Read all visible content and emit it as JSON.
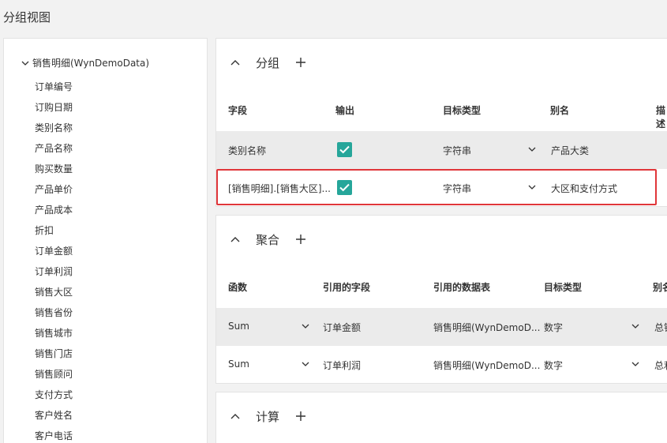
{
  "page": {
    "title": "分组视图"
  },
  "tree": {
    "root_label": "销售明细(WynDemoData)",
    "fields": [
      "订单编号",
      "订购日期",
      "类别名称",
      "产品名称",
      "购买数量",
      "产品单价",
      "产品成本",
      "折扣",
      "订单金额",
      "订单利润",
      "销售大区",
      "销售省份",
      "销售城市",
      "销售门店",
      "销售顾问",
      "支付方式",
      "客户姓名",
      "客户电话"
    ]
  },
  "group": {
    "title": "分组",
    "headers": {
      "field": "字段",
      "output": "输出",
      "target_type": "目标类型",
      "alias": "别名",
      "desc": "描述"
    },
    "rows": [
      {
        "field": "类别名称",
        "output": true,
        "target_type": "字符串",
        "alias": "产品大类"
      },
      {
        "field": "[销售明细].[销售大区]...",
        "output": true,
        "target_type": "字符串",
        "alias": "大区和支付方式"
      }
    ]
  },
  "aggregate": {
    "title": "聚合",
    "headers": {
      "func": "函数",
      "ref_field": "引用的字段",
      "ref_table": "引用的数据表",
      "target_type": "目标类型",
      "alias": "别名"
    },
    "rows": [
      {
        "func": "Sum",
        "ref_field": "订单金额",
        "ref_table": "销售明细(WynDemoD...",
        "target_type": "数字",
        "alias": "总销"
      },
      {
        "func": "Sum",
        "ref_field": "订单利润",
        "ref_table": "销售明细(WynDemoD...",
        "target_type": "数字",
        "alias": "总利"
      }
    ]
  },
  "calc": {
    "title": "计算"
  },
  "colors": {
    "accent": "#26a69a",
    "highlight": "#e0363a",
    "row_shade": "#ebebeb"
  }
}
